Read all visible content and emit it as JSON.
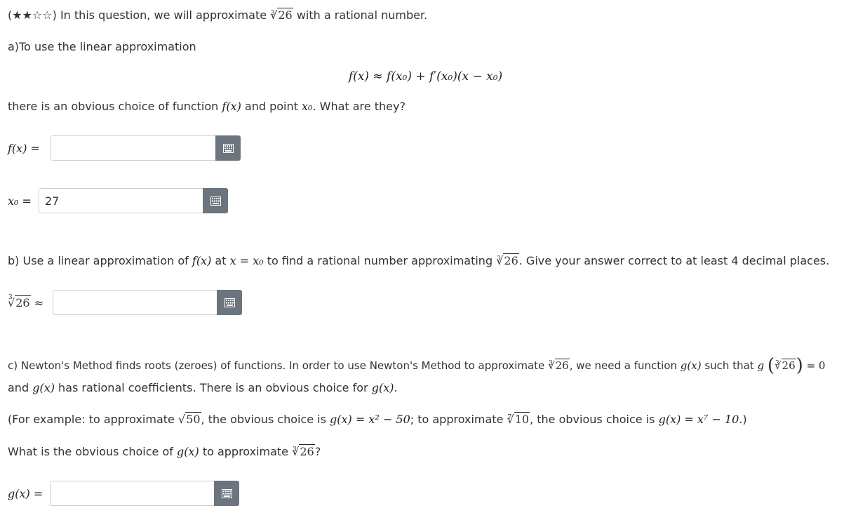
{
  "header": {
    "stars": "(★★☆☆)",
    "intro_before": "In this question, we will approximate",
    "root_index": "3",
    "root_radicand": "26",
    "intro_after": "with a rational number."
  },
  "part_a": {
    "prompt": "a)To use the linear approximation",
    "formula": "f(x) ≈ f(x₀) + f′(x₀)(x − x₀)",
    "question_before": "there is an obvious choice of function",
    "question_fx": "f(x)",
    "question_mid": "and point",
    "question_x0": "x₀",
    "question_after": ". What are they?",
    "fx_label": "f(x) =",
    "fx_value": "",
    "x0_label": "x₀ =",
    "x0_value": "27"
  },
  "part_b": {
    "prompt_before": "b) Use a linear approximation of",
    "prompt_fx": "f(x)",
    "prompt_at": "at",
    "prompt_eq": "x = x₀",
    "prompt_mid": "to find a rational number approximating",
    "prompt_root_index": "3",
    "prompt_root_radicand": "26",
    "prompt_after": ". Give your answer correct to at least 4 decimal places.",
    "label_approx": "≈",
    "answer_value": ""
  },
  "part_c": {
    "line1_before": "c) Newton's Method finds roots (zeroes) of functions. In order to use Newton's Method to approximate",
    "line1_mid": ", we need a function",
    "line1_gx": "g(x)",
    "line1_such": "such that",
    "line1_g": "g",
    "line1_eq": "= 0",
    "line2_before": "and",
    "line2_gx": "g(x)",
    "line2_mid": "has rational coefficients. There is an obvious choice for",
    "line2_gx2": "g(x)",
    "line2_after": ".",
    "example_1": "(For example: to approximate",
    "example_sqrt_radicand": "50",
    "example_2": ", the obvious choice is",
    "example_g1": "g(x) = x² − 50",
    "example_3": "; to approximate",
    "example_root7_index": "7",
    "example_root7_radicand": "10",
    "example_4": ", the obvious choice is",
    "example_g2": "g(x) = x⁷ − 10",
    "example_5": ".)",
    "question_before": "What is the obvious choice of",
    "question_gx": "g(x)",
    "question_mid": "to approximate",
    "question_after": "?",
    "gx_label": "g(x) =",
    "gx_value": ""
  },
  "icons": {
    "keyboard": "keyboard-icon"
  }
}
